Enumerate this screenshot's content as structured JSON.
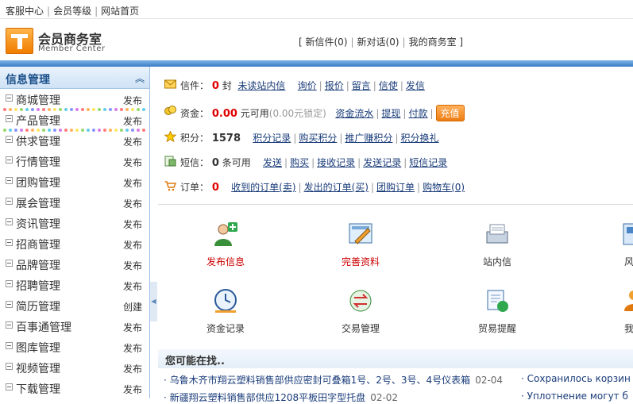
{
  "top_links": [
    "客服中心",
    "会员等级",
    "网站首页"
  ],
  "brand": {
    "title": "会员商务室",
    "subtitle": "Member Center"
  },
  "header_links": [
    "新信件(0)",
    "新对话(0)",
    "我的商务室"
  ],
  "sidebar": {
    "title": "信息管理",
    "items": [
      {
        "label": "商城管理",
        "action": "发布"
      },
      {
        "label": "产品管理",
        "action": "发布"
      },
      {
        "label": "供求管理",
        "action": "发布"
      },
      {
        "label": "行情管理",
        "action": "发布"
      },
      {
        "label": "团购管理",
        "action": "发布"
      },
      {
        "label": "展会管理",
        "action": "发布"
      },
      {
        "label": "资讯管理",
        "action": "发布"
      },
      {
        "label": "招商管理",
        "action": "发布"
      },
      {
        "label": "品牌管理",
        "action": "发布"
      },
      {
        "label": "招聘管理",
        "action": "发布"
      },
      {
        "label": "简历管理",
        "action": "创建"
      },
      {
        "label": "百事通管理",
        "action": "发布"
      },
      {
        "label": "图库管理",
        "action": "发布"
      },
      {
        "label": "视频管理",
        "action": "发布"
      },
      {
        "label": "下载管理",
        "action": "发布"
      }
    ]
  },
  "account": {
    "mail": {
      "label": "信件：",
      "count": "0",
      "unit": "封",
      "links": [
        "未读站内信",
        "询价",
        "报价",
        "留言",
        "信使",
        "发信"
      ]
    },
    "funds": {
      "label": "资金：",
      "amount": "0.00",
      "unit": "元可用",
      "locked": "(0.00元锁定)",
      "links": [
        "资金流水",
        "提现",
        "付款"
      ],
      "charge_label": "充值"
    },
    "points": {
      "label": "积分：",
      "amount": "1578",
      "links": [
        "积分记录",
        "购买积分",
        "推广赚积分",
        "积分换礼"
      ]
    },
    "sms": {
      "label": "短信：",
      "count": "0",
      "unit": "条可用",
      "links": [
        "发送",
        "购买",
        "接收记录",
        "发送记录",
        "短信记录"
      ]
    },
    "orders": {
      "label": "订单：",
      "count": "0",
      "links": [
        "收到的订单(卖)",
        "发出的订单(买)",
        "团购订单",
        "购物车(0)"
      ]
    }
  },
  "shortcuts": [
    {
      "label": "发布信息",
      "icon": "user-add-icon"
    },
    {
      "label": "完善资料",
      "icon": "profile-edit-icon"
    },
    {
      "label": "站内信",
      "icon": "inbox-icon"
    },
    {
      "label": "风格",
      "icon": "style-icon"
    },
    {
      "label": "资金记录",
      "icon": "clock-icon"
    },
    {
      "label": "交易管理",
      "icon": "exchange-icon"
    },
    {
      "label": "贸易提醒",
      "icon": "reminder-icon"
    },
    {
      "label": "我的",
      "icon": "people-icon"
    }
  ],
  "maybe": {
    "title": "您可能在找..",
    "items": [
      {
        "text": "乌鲁木齐市翔云塑料销售部供应密封可叠箱1号、2号、3号、4号仪表箱",
        "date": "02-04"
      },
      {
        "text": "新疆翔云塑料销售部供应1208平板田字型托盘",
        "date": "02-02"
      }
    ],
    "items_right": [
      "Сохранилось корзин",
      "Уплотнение могут б"
    ]
  },
  "colors": {
    "accent": "#3a7cc6",
    "alert": "#e10000",
    "orange": "#ee7c12"
  }
}
